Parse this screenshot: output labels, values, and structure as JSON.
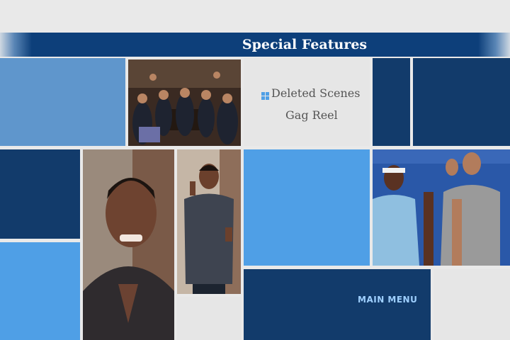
{
  "header": {
    "title": "Special Features"
  },
  "menu": {
    "items": [
      {
        "label": "Deleted Scenes",
        "selected": true
      },
      {
        "label": "Gag Reel",
        "selected": false
      }
    ],
    "main_menu_label": "MAIN MENU"
  },
  "colors": {
    "header_bar": "#0d3f7a",
    "tile_dark": "#123b6b",
    "tile_light": "#4f9fe6",
    "tile_mid": "#5f96cc",
    "background": "#e9e9e9"
  },
  "icons": {
    "selection": "grid-icon"
  }
}
